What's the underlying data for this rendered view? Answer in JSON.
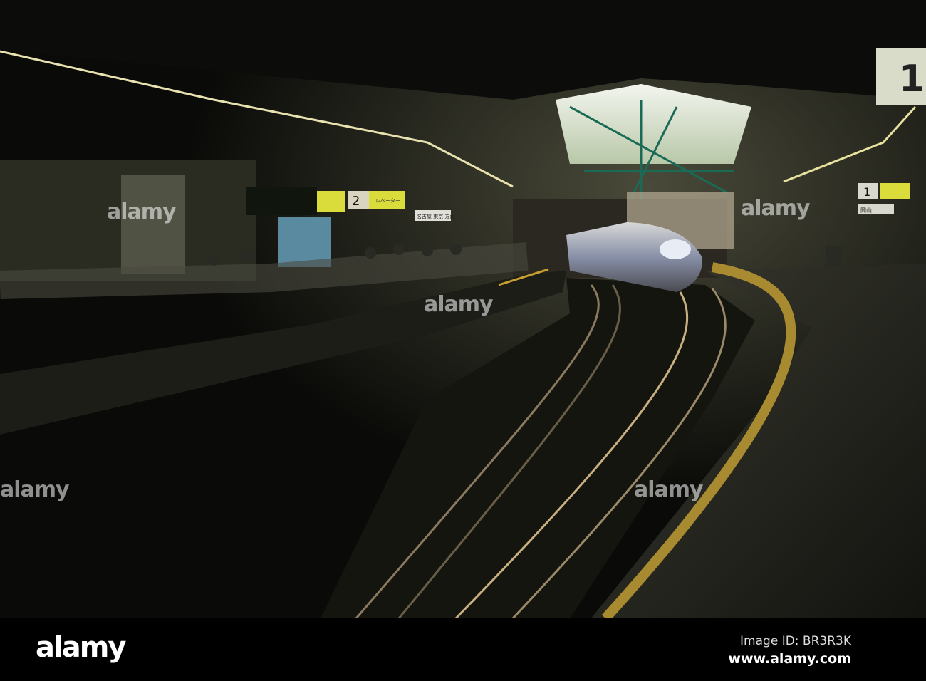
{
  "photo": {
    "signs": {
      "platform_1": "1",
      "platform_2": "2",
      "elevator": "エレベーター",
      "direction": "名古屋 東京 方面",
      "okayama": "岡山"
    },
    "watermark": "alamy"
  },
  "footer": {
    "logo": "alamy",
    "image_id": "Image ID: BR3R3K",
    "site": "www.alamy.com"
  }
}
